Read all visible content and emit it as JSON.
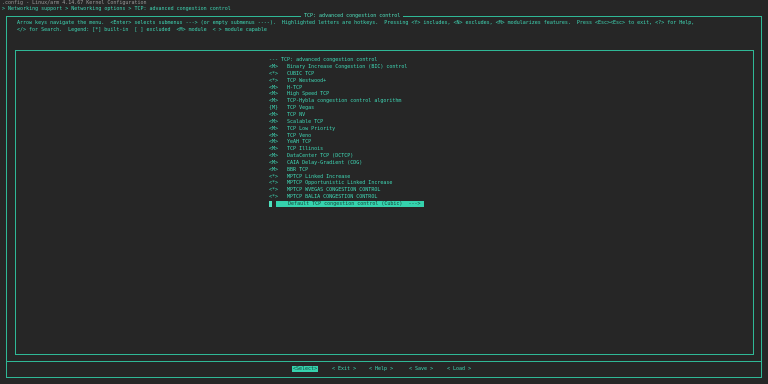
{
  "header": {
    "config_line": ".config - Linux/arm 4.14.67 Kernel Configuration",
    "breadcrumb": "> Networking support > Networking options > TCP: advanced congestion control"
  },
  "dialog": {
    "title": "TCP: advanced congestion control",
    "help_lines": [
      "Arrow keys navigate the menu.  <Enter> selects submenus ---> (or empty submenus ----).  Highlighted letters are hotkeys.  Pressing <Y> includes, <N> excludes, <M> modularizes features.  Press <Esc><Esc> to exit, <?> for Help,",
      "</> for Search.  Legend: [*] built-in  [ ] excluded  <M> module  < > module capable"
    ],
    "menu_header": "--- TCP: advanced congestion control",
    "items": [
      {
        "mark": "<M>",
        "label": "Binary Increase Congestion (BIC) control"
      },
      {
        "mark": "<*>",
        "label": "CUBIC TCP"
      },
      {
        "mark": "<*>",
        "label": "TCP Westwood+"
      },
      {
        "mark": "<M>",
        "label": "H-TCP"
      },
      {
        "mark": "<M>",
        "label": "High Speed TCP"
      },
      {
        "mark": "<M>",
        "label": "TCP-Hybla congestion control algorithm"
      },
      {
        "mark": "{M}",
        "label": "TCP Vegas"
      },
      {
        "mark": "<M>",
        "label": "TCP NV"
      },
      {
        "mark": "<M>",
        "label": "Scalable TCP"
      },
      {
        "mark": "<M>",
        "label": "TCP Low Priority"
      },
      {
        "mark": "<M>",
        "label": "TCP Veno"
      },
      {
        "mark": "<M>",
        "label": "YeAH TCP"
      },
      {
        "mark": "<M>",
        "label": "TCP Illinois"
      },
      {
        "mark": "<M>",
        "label": "DataCenter TCP (DCTCP)"
      },
      {
        "mark": "<M>",
        "label": "CAIA Delay-Gradient (CDG)"
      },
      {
        "mark": "<M>",
        "label": "BBR TCP"
      },
      {
        "mark": "<*>",
        "label": "MPTCP Linked Increase"
      },
      {
        "mark": "<*>",
        "label": "MPTCP Opportunistic Linked Increase"
      },
      {
        "mark": "<*>",
        "label": "MPTCP WVEGAS CONGESTION CONTROL"
      },
      {
        "mark": "<*>",
        "label": "MPTCP BALIA CONGESTION CONTROL"
      }
    ],
    "selected_item": "    Default TCP congestion control (Cubic)  --->"
  },
  "buttons": {
    "select": "<Select>",
    "exit": "< Exit >",
    "help": "< Help >",
    "save": "< Save >",
    "load": "< Load >"
  },
  "colors": {
    "background": "#262626",
    "accent": "#3fd6b4",
    "highlight": "#35d2ad"
  }
}
